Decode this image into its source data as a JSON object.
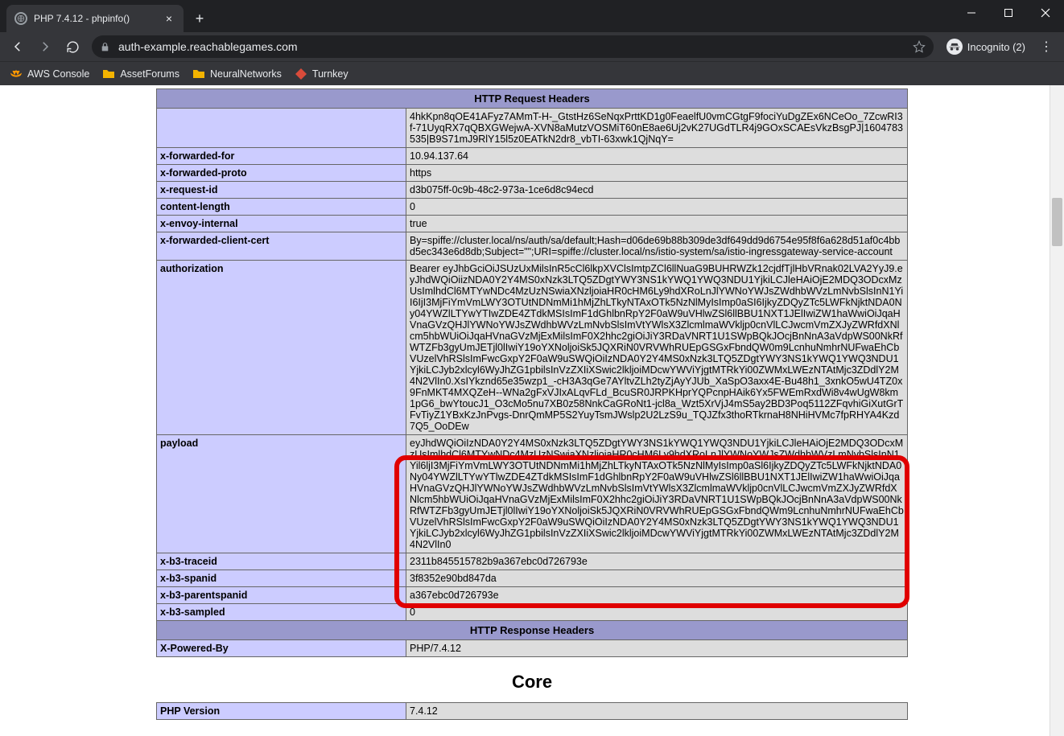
{
  "browser": {
    "tab_title": "PHP 7.4.12 - phpinfo()",
    "url": "auth-example.reachablegames.com",
    "incognito_label": "Incognito (2)"
  },
  "bookmarks": [
    {
      "label": "AWS Console",
      "icon": "aws"
    },
    {
      "label": "AssetForums",
      "icon": "folder"
    },
    {
      "label": "NeuralNetworks",
      "icon": "folder"
    },
    {
      "label": "Turnkey",
      "icon": "turnkey"
    }
  ],
  "sections": {
    "req_header": "HTTP Request Headers",
    "resp_header": "HTTP Response Headers",
    "core_heading": "Core"
  },
  "rows": {
    "truncated_top": "4hkKpn8qOE41AFyz7AMmT-H-_GtstHz6SeNqxPrttKD1g0FeaelfU0vmCGtgF9fociYuDgZEx6NCeOo_7ZcwRI3f-71UyqRX7qQBXGWejwA-XVN8aMutzVOSMiT60nE8ae6Uj2vK27UGdTLR4j9GOxSCAEsVkzBsgPJ|1604783535|B9S71mJ9RlY15l5z0EATkN2dr8_vbTI-63xwk1QjNqY=",
    "x_forwarded_for": {
      "k": "x-forwarded-for",
      "v": "10.94.137.64"
    },
    "x_forwarded_proto": {
      "k": "x-forwarded-proto",
      "v": "https"
    },
    "x_request_id": {
      "k": "x-request-id",
      "v": "d3b075ff-0c9b-48c2-973a-1ce6d8c94ecd"
    },
    "content_length": {
      "k": "content-length",
      "v": "0"
    },
    "x_envoy_internal": {
      "k": "x-envoy-internal",
      "v": "true"
    },
    "x_fwd_client_cert": {
      "k": "x-forwarded-client-cert",
      "v": "By=spiffe://cluster.local/ns/auth/sa/default;Hash=d06de69b88b309de3df649dd9d6754e95f8f6a628d51af0c4bbd5ec343e6d8db;Subject=\"\";URI=spiffe://cluster.local/ns/istio-system/sa/istio-ingressgateway-service-account"
    },
    "authorization": {
      "k": "authorization",
      "v": "Bearer eyJhbGciOiJSUzUxMilsInR5cCl6lkpXVClsImtpZCl6llNuaG9BUHRWZk12cjdfTjlHbVRnak02LVA2YyJ9.eyJhdWQiOiizNDA0Y2Y4MS0xNzk3LTQ5ZDgtYWY3NS1kYWQ1YWQ3NDU1YjkiLCJleHAiOjE2MDQ3ODcxMzUsImlhdCl6MTYwNDc4MzUzNSwiaXNzljoiaHR0cHM6Ly9hdXRoLnJlYWNoYWJsZWdhbWVzLmNvbSlsInN1YiI6IjI3MjFiYmVmLWY3OTUtNDNmMi1hMjZhLTkyNTAxOTk5NzNlMyIsImp0aSI6IjkyZDQyZTc5LWFkNjktNDA0Ny04YWZlLTYwYTIwZDE4ZTdkMSIsImF1dGhlbnRpY2F0aW9uVHlwZSl6llBBU1NXT1JElIwiZW1haWwiOiJqaHVnaGVzQHJlYWNoYWJsZWdhbWVzLmNvbSlsImVtYWlsX3ZlcmlmaWVkljp0cnVlLCJwcmVmZXJyZWRfdXNlcm5hbWUiOiJqaHVnaGVzMjExMilsImF0X2hhc2giOiJiY3RDaVNRT1U1SWpBQkJOcjBnNnA3aVdpWS00NkRfWTZFb3gyUmJETjl0lIwiY19oYXNoljoiSk5JQXRiN0VRVWhRUEpGSGxFbndQW0m9LcnhuNmhrNUFwaEhCbVUzelVhRSlsImFwcGxpY2F0aW9uSWQiOiIzNDA0Y2Y4MS0xNzk3LTQ5ZDgtYWY3NS1kYWQ1YWQ3NDU1YjkiLCJyb2xlcyl6WyJhZG1pbilsInVzZXIiXSwic2lkljoiMDcwYWViYjgtMTRkYi00ZWMxLWEzNTAtMjc3ZDdlY2M4N2VlIn0.XsIYkznd65e35wzp1_-cH3A3qGe7AYltvZLh2tyZjAyYJUb_XaSpO3axx4E-Bu48h1_3xnkO5wU4TZ0x9FnMKT4MXQZeH--WNa2gFxVJIxALqvFLd_BcuSR0JRPKHprYQPcnpHAik6Yx5FWEmRxdWi8v4wUgW8km1pG6_bwYtoucJ1_O3cMo5nu7XB0z58NnkCaGRoNt1-jcl8a_Wzt5XrVjJ4mS5ay2BD3Poq5112ZFqvhiGiXutGrTFvTiyZ1YBxKzJnPvgs-DnrQmMP5S2YuyTsmJWslp2U2LzS9u_TQJZfx3thoRTkrnaH8NHiHVMc7fpRHYA4Kzd7Q5_OoDEw"
    },
    "payload": {
      "k": "payload",
      "v": "eyJhdWQiOiIzNDA0Y2Y4MS0xNzk3LTQ5ZDgtYWY3NS1kYWQ1YWQ3NDU1YjkiLCJleHAiOjE2MDQ3ODcxMzUsImlhdCl6MTYwNDc4MzUzNSwiaXNzljoiaHR0cHM6Ly9hdXRoLnJlYWNoYWJsZWdhbWVzLmNvbSlsInN1Yil6ljI3MjFiYmVmLWY3OTUtNDNmMi1hMjZhLTkyNTAxOTk5NzNlMyIsImp0aSl6IjkyZDQyZTc5LWFkNjktNDA0Ny04YWZlLTYwYTlwZDE4ZTdkMSIsImF1dGhlbnRpY2F0aW9uVHlwZSl6llBBU1NXT1JElIwiZW1haWwiOiJqaHVnaGVzQHJlYWNoYWJsZWdhbWVzLmNvbSlsImVtYWlsX3ZlcmlmaWVkljp0cnVlLCJwcmVmZXJyZWRfdXNlcm5hbWUiOiJqaHVnaGVzMjExMilsImF0X2hhc2giOiJiY3RDaVNRT1U1SWpBQkJOcjBnNnA3aVdpWS00NkRfWTZFb3gyUmJETjl0lIwiY19oYXNoljoiSk5JQXRiN0VRVWhRUEpGSGxFbndQWm9LcnhuNmhrNUFwaEhCbVUzelVhRSlsImFwcGxpY2F0aW9uSWQiOiIzNDA0Y2Y4MS0xNzk3LTQ5ZDgtYWY3NS1kYWQ1YWQ3NDU1YjkiLCJyb2xlcyl6WyJhZG1pbilsInVzZXIiXSwic2lkljoiMDcwYWViYjgtMTRkYi00ZWMxLWEzNTAtMjc3ZDdlY2M4N2VlIn0"
    },
    "x_b3_traceid": {
      "k": "x-b3-traceid",
      "v": "2311b845515782b9a367ebc0d726793e"
    },
    "x_b3_spanid": {
      "k": "x-b3-spanid",
      "v": "3f8352e90bd847da"
    },
    "x_b3_parentspanid": {
      "k": "x-b3-parentspanid",
      "v": "a367ebc0d726793e"
    },
    "x_b3_sampled": {
      "k": "x-b3-sampled",
      "v": "0"
    },
    "x_powered_by": {
      "k": "X-Powered-By",
      "v": "PHP/7.4.12"
    },
    "php_version": {
      "k": "PHP Version",
      "v": "7.4.12"
    }
  }
}
